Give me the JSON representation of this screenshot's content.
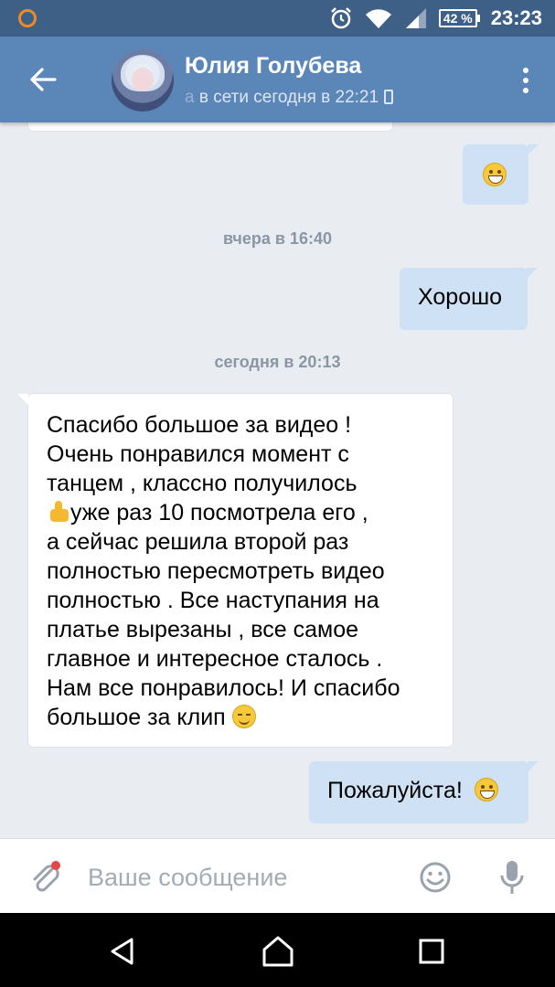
{
  "status_bar": {
    "time": "23:23",
    "battery": "42 %"
  },
  "header": {
    "contact_name": "Юлия Голубева",
    "status_prefix": "а ",
    "status_text": "в сети сегодня в 22:21"
  },
  "chat": {
    "date_yesterday": "вчера в 16:40",
    "date_today": "сегодня в 20:13",
    "msg_out_ok": "Хорошо",
    "msg_in_lines": [
      "Спасибо большое за видео !",
      "Очень понравился момент с",
      "танцем , классно получилось",
      "уже раз 10 посмотрела его ,",
      "а сейчас решила второй раз",
      "полностью пересмотреть видео",
      "полностью . Все наступания на",
      "платье вырезаны , все самое",
      "главное и интересное сталось .",
      "Нам все понравилось! И спасибо",
      "большое за клип"
    ],
    "msg_out_reply": "Пожалуйста!"
  },
  "input": {
    "placeholder": "Ваше сообщение"
  },
  "colors": {
    "status_bar": "#3e5f86",
    "header": "#5b86b8",
    "chat_bg": "#e9edf1",
    "outgoing_bubble": "#cfe1f5",
    "incoming_bubble": "#ffffff"
  },
  "icons": {
    "back": "arrow-left-icon",
    "menu": "more-vertical-icon",
    "attach": "paperclip-icon",
    "emoji": "smiley-icon",
    "mic": "microphone-icon",
    "nav_back": "triangle-back-icon",
    "nav_home": "home-icon",
    "nav_recent": "square-recent-icon"
  }
}
